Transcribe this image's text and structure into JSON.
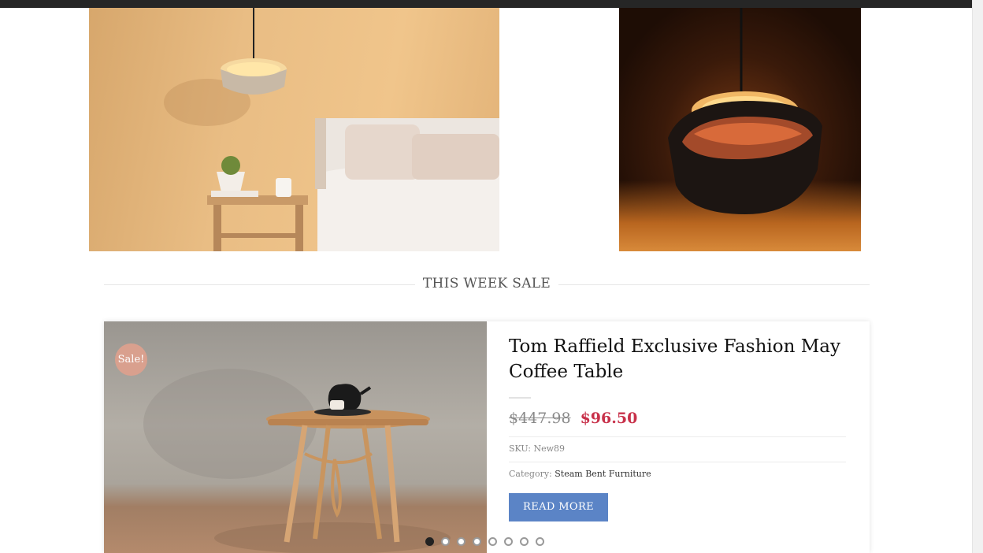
{
  "section": {
    "title": "THIS WEEK SALE"
  },
  "product": {
    "badge": "Sale!",
    "title": "Tom Raffield Exclusive Fashion May Coffee Table",
    "price_old": "$447.98",
    "price_new": "$96.50",
    "sku_label": "SKU:",
    "sku_value": "New89",
    "category_label": "Category:",
    "category_value": "Steam Bent Furniture",
    "read_more_label": "READ MORE"
  },
  "carousel": {
    "dot_count": 8,
    "active_index": 0
  },
  "colors": {
    "topbar": "#262626",
    "sale_price": "#c8314a",
    "button": "#5b84c6",
    "badge": "#d9a08e"
  }
}
